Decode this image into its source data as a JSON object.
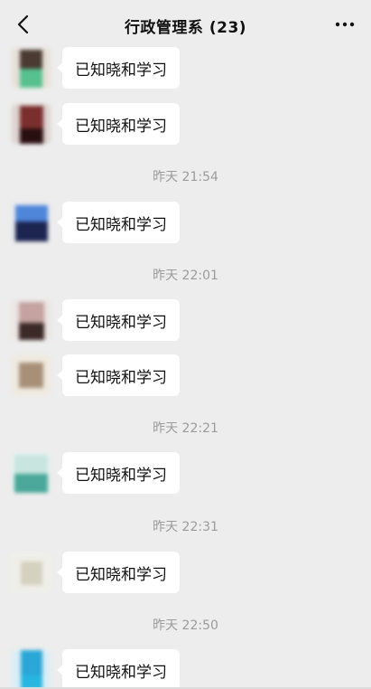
{
  "header": {
    "title": "行政管理系 (23)"
  },
  "messages": [
    {
      "type": "msg",
      "text": "已知晓和学习"
    },
    {
      "type": "msg",
      "text": "已知晓和学习"
    },
    {
      "type": "time",
      "text": "昨天 21:54"
    },
    {
      "type": "msg",
      "text": "已知晓和学习"
    },
    {
      "type": "time",
      "text": "昨天 22:01"
    },
    {
      "type": "msg",
      "text": "已知晓和学习"
    },
    {
      "type": "msg",
      "text": "已知晓和学习"
    },
    {
      "type": "time",
      "text": "昨天 22:21"
    },
    {
      "type": "msg",
      "text": "已知晓和学习"
    },
    {
      "type": "time",
      "text": "昨天 22:31"
    },
    {
      "type": "msg",
      "text": "已知晓和学习"
    },
    {
      "type": "time",
      "text": "昨天 22:50"
    },
    {
      "type": "msg",
      "text": "已知晓和学习"
    }
  ],
  "colors": {
    "background": "#ededed",
    "bubble": "#ffffff",
    "timestamp": "#9b9b9b",
    "avatars": [
      {
        "top": "#4a3a32",
        "bottom": "#56c08e"
      },
      {
        "top": "#7a2f2e",
        "bottom": "#2a0f10"
      },
      {
        "top": "#4f86d9",
        "bottom": "#1c2550"
      },
      {
        "top": "#c4a3a0",
        "bottom": "#3b2a28"
      },
      {
        "top": "#a89078",
        "bottom": "#a89078"
      },
      {
        "top": "#c8e6df",
        "bottom": "#4aa79a"
      },
      {
        "top": "#d4d1bf",
        "bottom": "#d4d1bf"
      },
      {
        "top": "#2aa7d6",
        "bottom": "#27b6e0"
      }
    ]
  },
  "icons": {
    "back": "chevron-left-icon",
    "more": "more-dots-icon"
  }
}
